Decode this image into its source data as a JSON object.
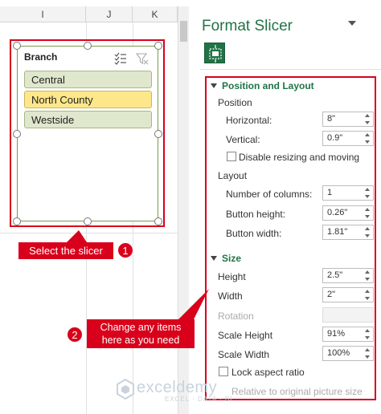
{
  "sheet": {
    "columns": [
      "I",
      "J",
      "K"
    ]
  },
  "slicer": {
    "title": "Branch",
    "items": [
      "Central",
      "North County",
      "Westside"
    ],
    "selected_index": 1
  },
  "callout1": {
    "text": "Select the slicer",
    "badge": "1"
  },
  "callout2": {
    "text": "Change any items here as you need",
    "badge": "2"
  },
  "pane": {
    "title": "Format Slicer",
    "position_layout": {
      "header": "Position and Layout",
      "position_label": "Position",
      "horizontal_label": "Horizontal:",
      "horizontal_value": "8\"",
      "vertical_label": "Vertical:",
      "vertical_value": "0.9\"",
      "disable_label": "Disable resizing and moving",
      "layout_label": "Layout",
      "columns_label": "Number of columns:",
      "columns_value": "1",
      "btn_height_label": "Button height:",
      "btn_height_value": "0.26\"",
      "btn_width_label": "Button width:",
      "btn_width_value": "1.81\""
    },
    "size": {
      "header": "Size",
      "height_label": "Height",
      "height_value": "2.5\"",
      "width_label": "Width",
      "width_value": "2\"",
      "rotation_label": "Rotation",
      "scale_height_label": "Scale Height",
      "scale_height_value": "91%",
      "scale_width_label": "Scale Width",
      "scale_width_value": "100%",
      "lock_label": "Lock aspect ratio",
      "relative_label": "Relative to original picture size"
    }
  },
  "watermark": {
    "brand": "exceldemy",
    "tagline": "EXCEL · DATA · BI"
  },
  "colors": {
    "accent_green": "#217346",
    "annotation_red": "#d9001b",
    "selected_item": "#fde78a",
    "item_bg": "#dfe7cd"
  }
}
